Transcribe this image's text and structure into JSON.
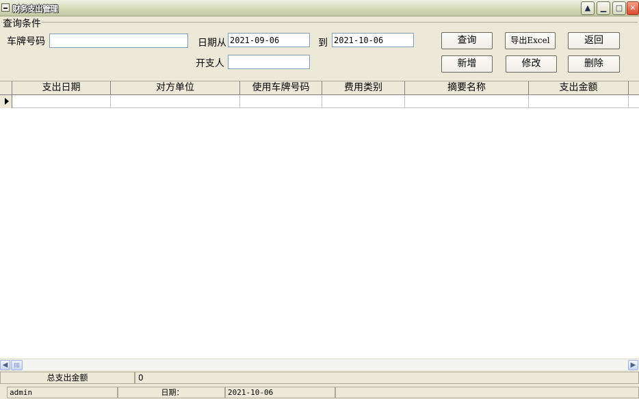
{
  "window": {
    "title": "财务支出管理"
  },
  "query": {
    "group_title": "查询条件",
    "plate_label": "车牌号码",
    "plate_value": "",
    "date_from_label": "日期从",
    "date_from": "2021-09-06",
    "date_to_label": "到",
    "date_to": "2021-10-06",
    "payer_label": "开支人",
    "payer_value": ""
  },
  "buttons": {
    "search": "查询",
    "export": "导出Excel",
    "back": "返回",
    "add": "新增",
    "edit": "修改",
    "delete": "删除"
  },
  "table": {
    "columns": [
      "支出日期",
      "对方单位",
      "使用车牌号码",
      "费用类别",
      "摘要名称",
      "支出金额"
    ],
    "rows": []
  },
  "totals": {
    "label": "总支出金额",
    "value": "0"
  },
  "status": {
    "user": "admin",
    "date_label": "日期：",
    "date_value": "2021-10-06"
  },
  "icons": {
    "system_menu": "system-menu-icon",
    "help": "up-arrow-icon",
    "minimize": "minimize-icon",
    "maximize": "maximize-icon",
    "close": "close-icon",
    "row_indicator": "current-row-arrow-icon"
  }
}
